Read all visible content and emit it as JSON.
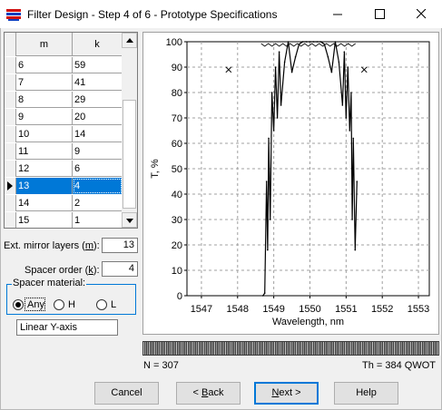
{
  "window": {
    "title": "Filter Design - Step 4 of 6 - Prototype Specifications"
  },
  "table": {
    "headers": [
      "m",
      "k"
    ],
    "rows": [
      {
        "m": "6",
        "k": "59"
      },
      {
        "m": "7",
        "k": "41"
      },
      {
        "m": "8",
        "k": "29"
      },
      {
        "m": "9",
        "k": "20"
      },
      {
        "m": "10",
        "k": "14"
      },
      {
        "m": "11",
        "k": "9"
      },
      {
        "m": "12",
        "k": "6"
      },
      {
        "m": "13",
        "k": "4"
      },
      {
        "m": "14",
        "k": "2"
      },
      {
        "m": "15",
        "k": "1"
      }
    ],
    "selected_row": 7
  },
  "form": {
    "ext_mirror_label_pre": "Ext. mirror layers (",
    "ext_mirror_key": "m",
    "ext_mirror_label_post": "):",
    "ext_mirror_value": "13",
    "spacer_order_label_pre": "Spacer order (",
    "spacer_order_key": "k",
    "spacer_order_label_post": "):",
    "spacer_order_value": "4",
    "spacer_material_label": "Spacer material:",
    "spacer_options": [
      "Any",
      "H",
      "L"
    ],
    "spacer_selected": "Any",
    "axis_mode": "Linear Y-axis"
  },
  "chart_data": {
    "type": "line",
    "xlabel": "Wavelength, nm",
    "ylabel": "T, %",
    "xlim": [
      1546.6,
      1553.3
    ],
    "ylim": [
      0,
      100
    ],
    "xticks": [
      "1547",
      "1548",
      "1549",
      "1550",
      "1551",
      "1552",
      "1553"
    ],
    "yticks": [
      "0",
      "10",
      "20",
      "30",
      "40",
      "50",
      "60",
      "70",
      "80",
      "90",
      "100"
    ],
    "grid": true,
    "series": [
      {
        "x": [
          1548.7,
          1548.75,
          1548.8,
          1548.83,
          1548.86,
          1548.9,
          1548.95,
          1549.0,
          1549.05,
          1549.1,
          1549.15,
          1549.2,
          1549.3,
          1549.4,
          1549.5,
          1549.6,
          1549.7,
          1549.8,
          1549.9,
          1550.0,
          1550.1,
          1550.2,
          1550.3,
          1550.4,
          1550.5,
          1550.6,
          1550.7,
          1550.8,
          1550.9,
          1550.95,
          1551.0,
          1551.05,
          1551.1,
          1551.14,
          1551.17,
          1551.2,
          1551.25,
          1551.3
        ],
        "y": [
          0,
          1,
          45,
          18,
          62,
          30,
          80,
          65,
          90,
          70,
          96,
          75,
          92,
          100,
          88,
          94,
          99,
          100,
          100,
          100,
          100,
          100,
          100,
          99,
          94,
          88,
          100,
          92,
          75,
          96,
          70,
          90,
          65,
          80,
          30,
          62,
          18,
          45
        ]
      }
    ],
    "target_markers": [
      {
        "x": 1547.75,
        "y": 89
      },
      {
        "x": 1551.5,
        "y": 89
      }
    ]
  },
  "status": {
    "left": "N = 307",
    "right": "Th = 384 QWOT"
  },
  "buttons": {
    "cancel": "Cancel",
    "back_arrow": "< ",
    "back_key": "B",
    "back_rest": "ack",
    "next_key": "N",
    "next_rest": "ext >",
    "help": "Help"
  }
}
